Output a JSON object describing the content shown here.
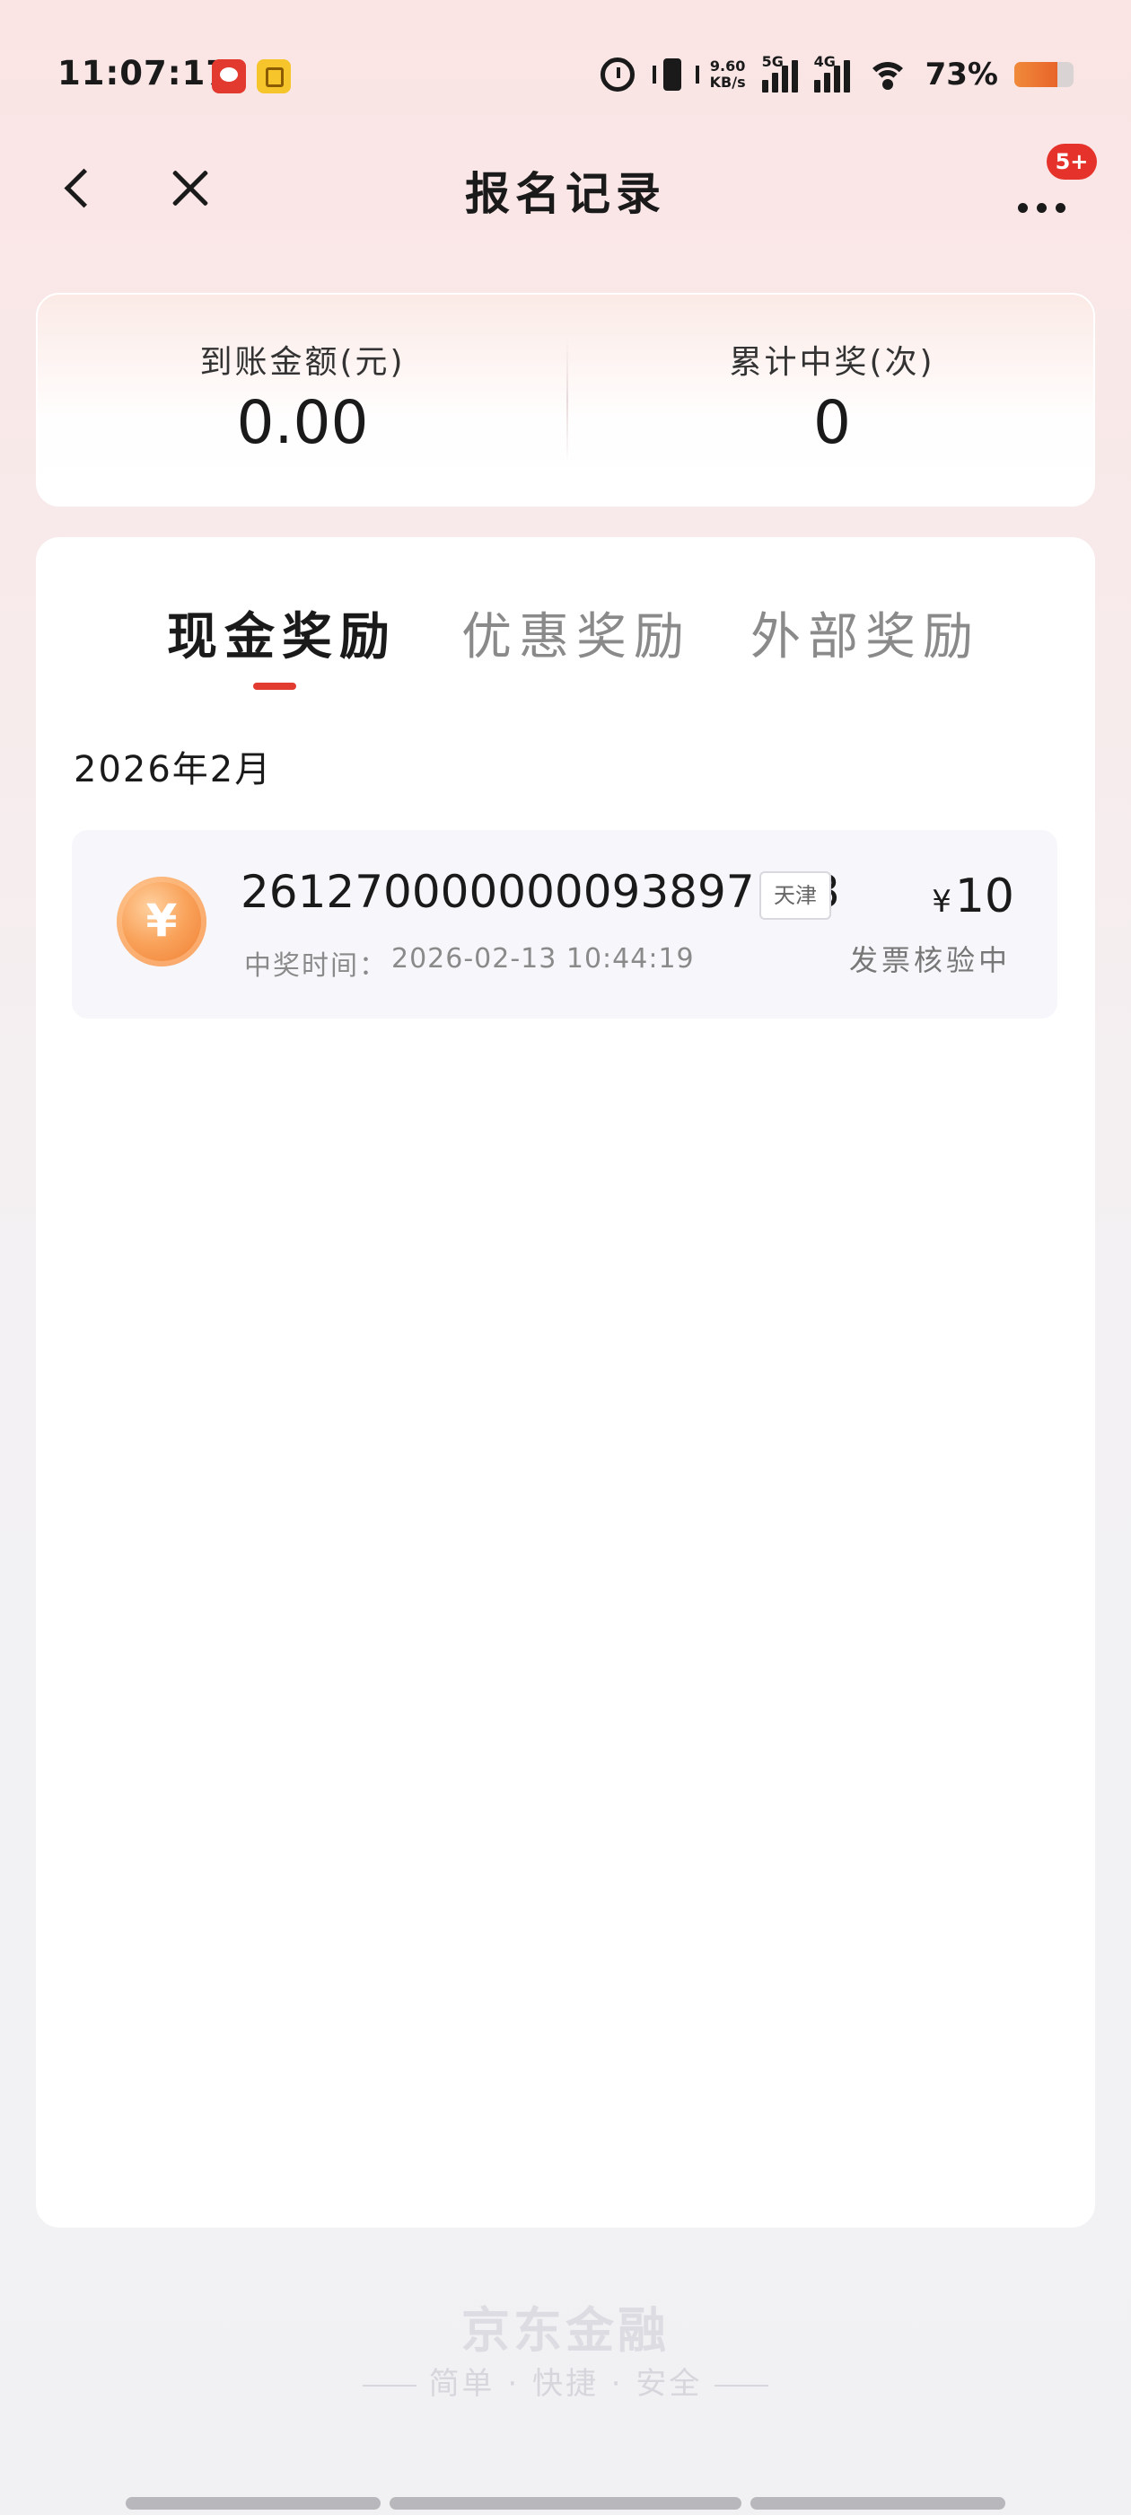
{
  "status_bar": {
    "time": "11:07:17",
    "net_speed_value": "9.60",
    "net_speed_unit": "KB/s",
    "signal1_label": "5G",
    "signal2_label": "4G",
    "battery_pct": "73%",
    "battery_level": 0.73
  },
  "nav": {
    "title": "报名记录",
    "badge": "5+"
  },
  "summary": {
    "amount_label": "到账金额(元)",
    "amount_value": "0.00",
    "wins_label": "累计中奖(次)",
    "wins_value": "0"
  },
  "tabs": [
    {
      "label": "现金奖励",
      "active": true
    },
    {
      "label": "优惠奖励",
      "active": false
    },
    {
      "label": "外部奖励",
      "active": false
    }
  ],
  "month": "2026年2月",
  "records": [
    {
      "coin_symbol": "¥",
      "id": "261270000000093897173",
      "tag": "天津",
      "time_label": "中奖时间：",
      "time": "2026-02-13 10:44:19",
      "currency": "¥",
      "amount": "10",
      "status": "发票核验中"
    }
  ],
  "footer": {
    "brand": "京东金融",
    "slogan": "简单 · 快捷 · 安全"
  },
  "colors": {
    "accent": "#e23b30",
    "badge": "#e5322b"
  }
}
